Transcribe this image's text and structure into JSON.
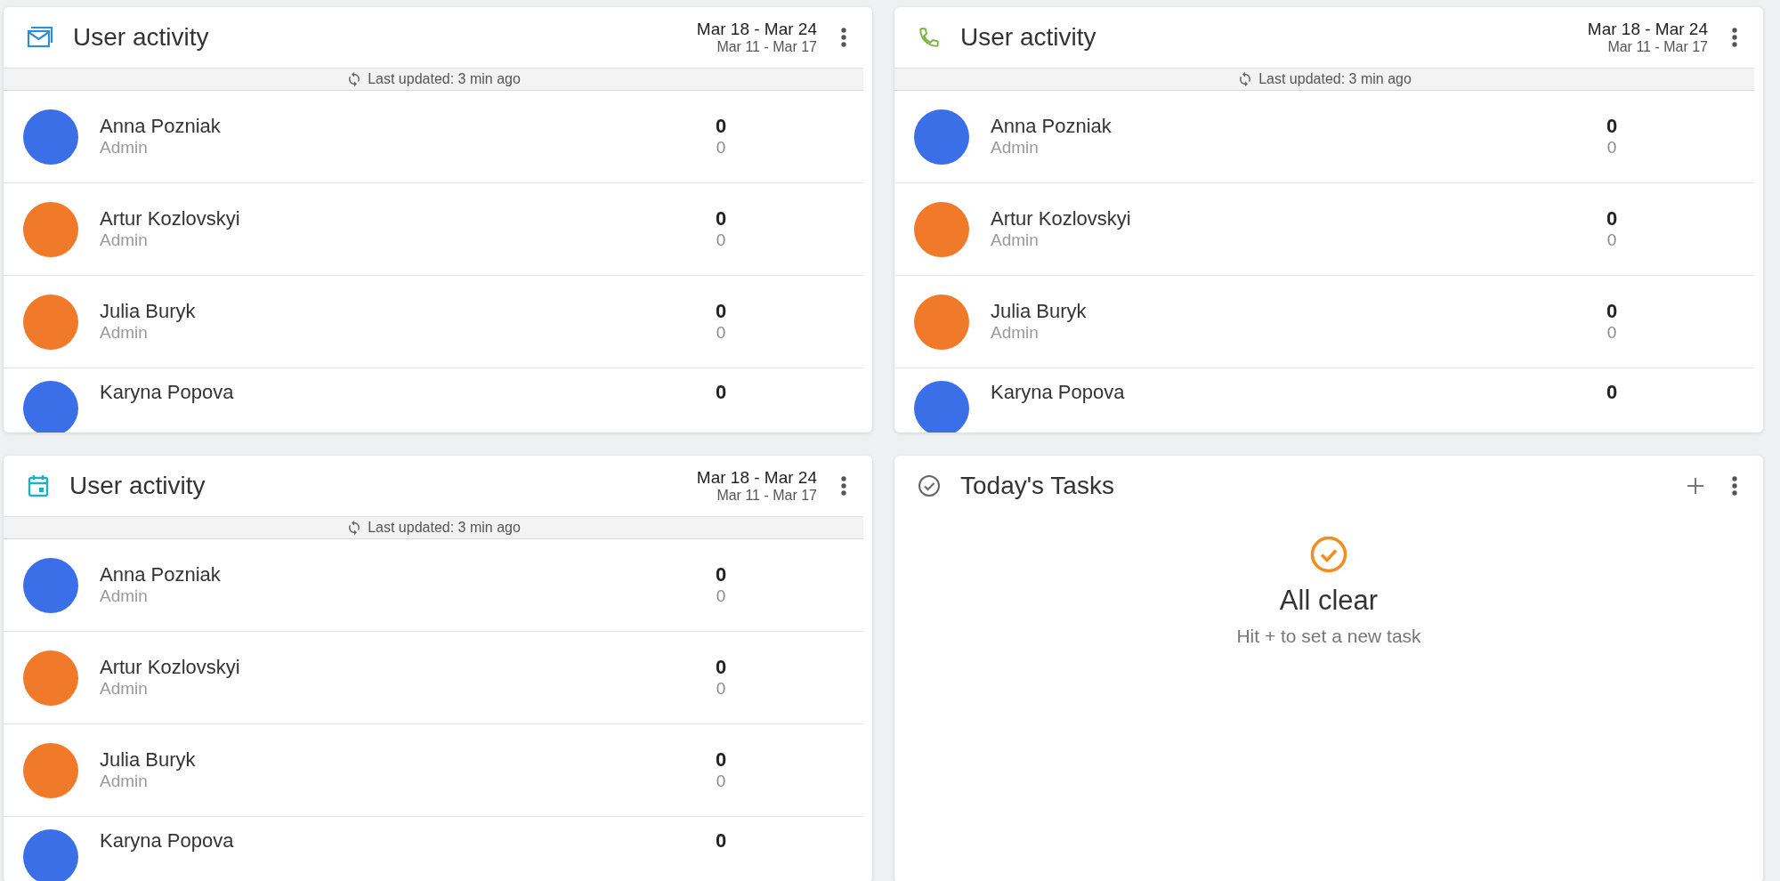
{
  "widgets": [
    {
      "kind": "mail",
      "title": "User activity",
      "current_range": "Mar 18 - Mar 24",
      "previous_range": "Mar 11 - Mar 17",
      "updated": "Last updated: 3 min ago",
      "users": [
        {
          "name": "Anna Pozniak",
          "role": "Admin",
          "current": "0",
          "previous": "0",
          "color": "#3b6fe8"
        },
        {
          "name": "Artur Kozlovskyi",
          "role": "Admin",
          "current": "0",
          "previous": "0",
          "color": "#f07a2a"
        },
        {
          "name": "Julia Buryk",
          "role": "Admin",
          "current": "0",
          "previous": "0",
          "color": "#f07a2a"
        },
        {
          "name": "Karyna Popova",
          "current": "0",
          "color": "#3b6fe8"
        }
      ]
    },
    {
      "kind": "phone",
      "title": "User activity",
      "current_range": "Mar 18 - Mar 24",
      "previous_range": "Mar 11 - Mar 17",
      "updated": "Last updated: 3 min ago",
      "users": [
        {
          "name": "Anna Pozniak",
          "role": "Admin",
          "current": "0",
          "previous": "0",
          "color": "#3b6fe8"
        },
        {
          "name": "Artur Kozlovskyi",
          "role": "Admin",
          "current": "0",
          "previous": "0",
          "color": "#f07a2a"
        },
        {
          "name": "Julia Buryk",
          "role": "Admin",
          "current": "0",
          "previous": "0",
          "color": "#f07a2a"
        },
        {
          "name": "Karyna Popova",
          "current": "0",
          "color": "#3b6fe8"
        }
      ]
    },
    {
      "kind": "calendar",
      "title": "User activity",
      "current_range": "Mar 18 - Mar 24",
      "previous_range": "Mar 11 - Mar 17",
      "updated": "Last updated: 3 min ago",
      "users": [
        {
          "name": "Anna Pozniak",
          "role": "Admin",
          "current": "0",
          "previous": "0",
          "color": "#3b6fe8"
        },
        {
          "name": "Artur Kozlovskyi",
          "role": "Admin",
          "current": "0",
          "previous": "0",
          "color": "#f07a2a"
        },
        {
          "name": "Julia Buryk",
          "role": "Admin",
          "current": "0",
          "previous": "0",
          "color": "#f07a2a"
        },
        {
          "name": "Karyna Popova",
          "current": "0",
          "color": "#3b6fe8"
        }
      ]
    },
    {
      "kind": "tasks",
      "title": "Today's Tasks",
      "empty_title": "All clear",
      "empty_hint": "Hit + to set a new task"
    }
  ]
}
